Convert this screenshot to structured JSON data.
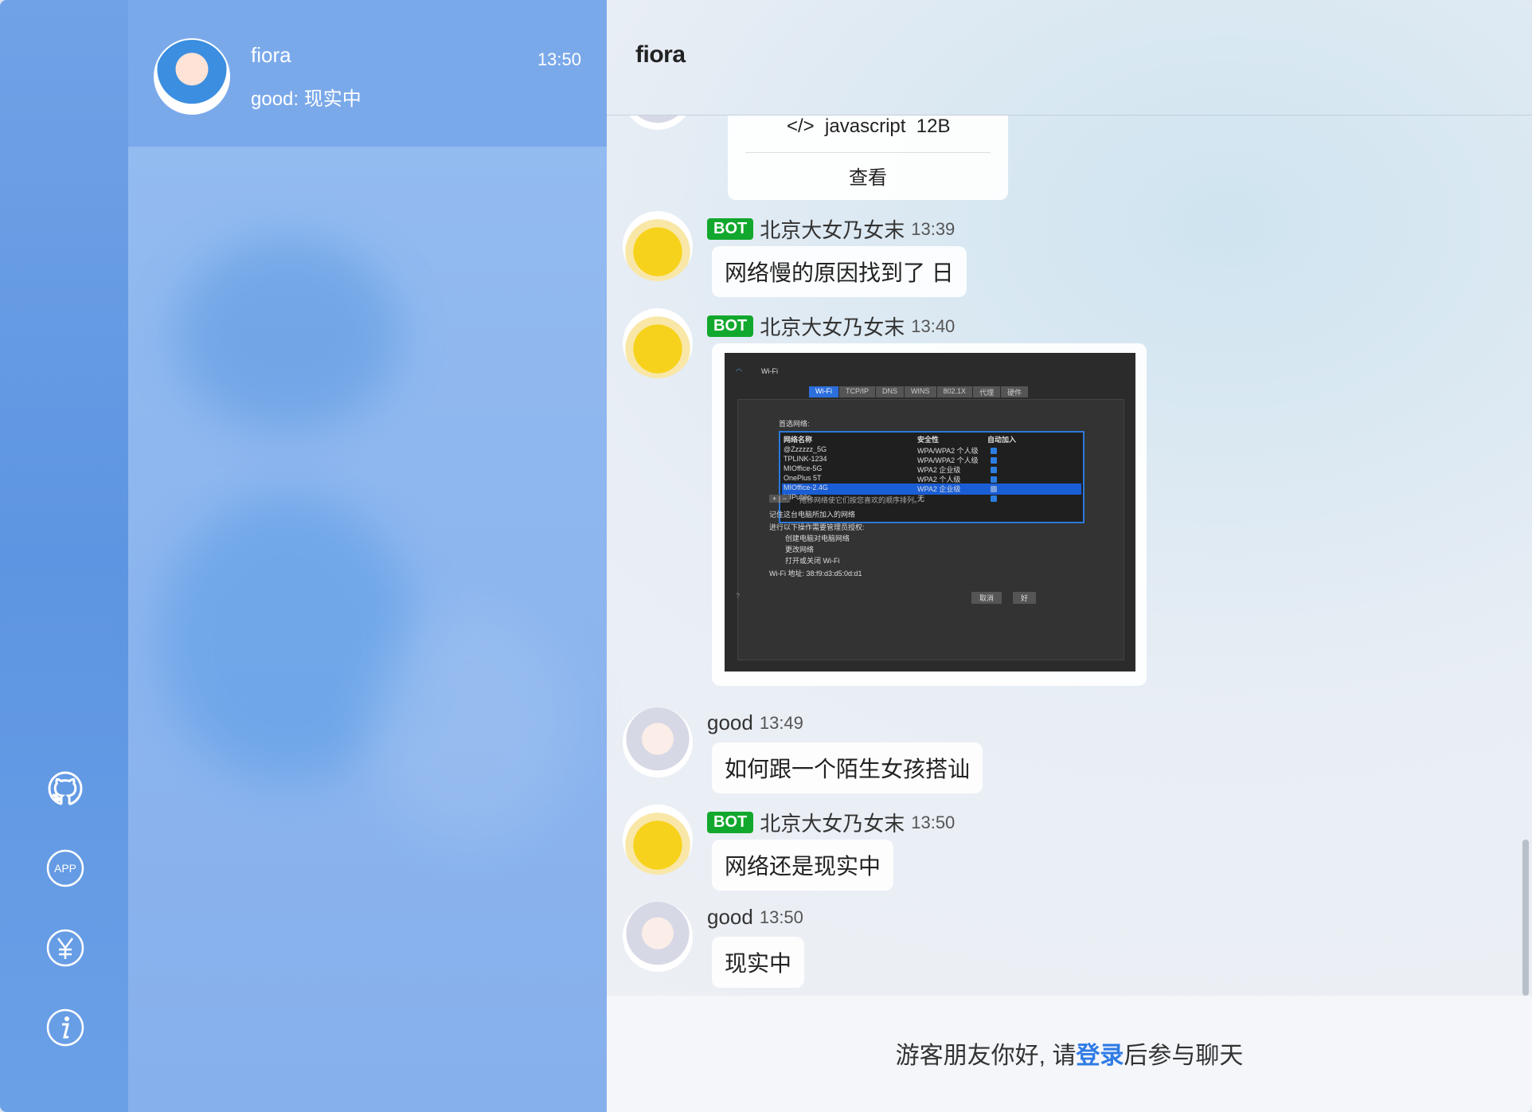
{
  "sidebar": {
    "icons": [
      "github-icon",
      "app-download-icon",
      "reward-icon",
      "about-icon"
    ],
    "app_label": "APP"
  },
  "linkman": {
    "name": "fiora",
    "time": "13:50",
    "preview": "good: 现实中"
  },
  "chat": {
    "title": "fiora",
    "messages": [
      {
        "type": "code",
        "language": "javascript",
        "size": "12B",
        "action": "查看"
      },
      {
        "nick": "北京大女乃女末",
        "bot": true,
        "bot_tag": "BOT",
        "time": "13:39",
        "text": "网络慢的原因找到了 日"
      },
      {
        "nick": "北京大女乃女末",
        "bot": true,
        "bot_tag": "BOT",
        "time": "13:40",
        "type": "image"
      },
      {
        "nick": "good",
        "bot": false,
        "time": "13:49",
        "text": "如何跟一个陌生女孩搭讪"
      },
      {
        "nick": "北京大女乃女末",
        "bot": true,
        "bot_tag": "BOT",
        "time": "13:50",
        "text": "网络还是现实中"
      },
      {
        "nick": "good",
        "bot": false,
        "time": "13:50",
        "text": "现实中"
      }
    ],
    "image": {
      "window_title": "Wi-Fi",
      "tabs": [
        "Wi-Fi",
        "TCP/IP",
        "DNS",
        "WINS",
        "802.1X",
        "代理",
        "硬件"
      ],
      "section_label": "首选网络:",
      "columns": [
        "网络名称",
        "安全性",
        "自动加入"
      ],
      "rows": [
        [
          "@Zzzzzz_5G",
          "WPA/WPA2 个人级"
        ],
        [
          "TPLINK-1234",
          "WPA/WPA2 个人级"
        ],
        [
          "MIOffice-5G",
          "WPA2 企业级"
        ],
        [
          "OnePlus 5T",
          "WPA2 个人级"
        ],
        [
          "MIOffice-2.4G",
          "WPA2 企业级"
        ],
        [
          "MIPublic",
          "无"
        ]
      ],
      "hint": "拖移网络使它们按您喜欢的顺序排列。",
      "remember": "记住这台电脑所加入的网络",
      "admin": "进行以下操作需要管理员授权:",
      "opt1": "创建电脑对电脑网络",
      "opt2": "更改网络",
      "opt3": "打开或关闭 Wi-Fi",
      "address": "Wi-Fi 地址:   38:f9:d3:d5:0d:d1",
      "cancel": "取消",
      "ok": "好"
    }
  },
  "footer": {
    "prefix": "游客朋友你好, 请",
    "login": "登录",
    "suffix": "后参与聊天"
  },
  "colors": {
    "accent": "#2f7be5",
    "bot_tag": "#12a82e",
    "rail": "#6fa2e6"
  }
}
